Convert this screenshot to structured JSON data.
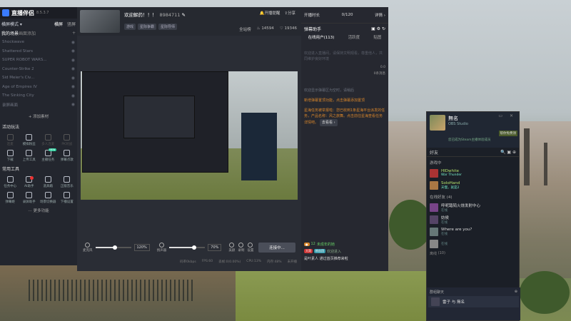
{
  "left_panel": {
    "app_name": "直播伴侣",
    "version": "8.5.3.7",
    "mode": "横屏模式 ▾",
    "mode_options": [
      "横屏",
      "竖屏"
    ],
    "tabs": [
      "我的场景",
      "画面",
      "添加"
    ],
    "scenes": [
      "Shockwave",
      "Shattered Stars",
      "SUPER ROBOT WARS...",
      "Counter-Strike 2",
      "Sid Meier's Civ...",
      "Age of Empires IV",
      "The Sinking City",
      "录屏画面"
    ],
    "add_material": "+ 添加素材",
    "activity_title": "活动玩法",
    "activity_items": [
      {
        "label": "连麦",
        "dim": true
      },
      {
        "label": "模拟粉丝",
        "dim": false
      },
      {
        "label": "多人连麦",
        "dim": true
      },
      {
        "label": "PK对战",
        "dim": true
      },
      {
        "label": "下载",
        "dim": false
      },
      {
        "label": "上传工具",
        "dim": false
      },
      {
        "label": "主播任务",
        "dim": false,
        "new_badge": "NEW"
      },
      {
        "label": "弹幕点歌",
        "dim": false
      }
    ],
    "tools_title": "常用工具",
    "tool_items": [
      {
        "label": "任务中心",
        "dot": false
      },
      {
        "label": "AI助手",
        "dot": true
      },
      {
        "label": "道具箱",
        "dot": false
      },
      {
        "label": "正版音乐",
        "dot": false
      },
      {
        "label": "弹幕姬",
        "dot": false
      },
      {
        "label": "录屏助手",
        "dot": false
      },
      {
        "label": "场景切换器",
        "dot": false
      },
      {
        "label": "下播设置",
        "dot": false
      }
    ],
    "more_func": "更多功能"
  },
  "main": {
    "title": "欢迎解药！！！",
    "room_id": "8984711",
    "tags": [
      "游戏",
      "星际争霸",
      "星际导师"
    ],
    "actions": [
      "开播提醒",
      "分享"
    ],
    "stats": {
      "label": "全站榜",
      "viewers": "14594",
      "likes": "19346"
    },
    "mic_label": "麦克风",
    "mic_percent": "120%",
    "speaker_label": "扬声器",
    "speaker_percent": "70%",
    "tool_icons": [
      "美颜",
      "录制",
      "设置"
    ],
    "connect_label": "连接中...",
    "mic_level": 0.55,
    "speaker_level": 0.7,
    "status": [
      "码率0kbps",
      "FPS:60",
      "丢帧:0(0.00%)",
      "CPU:13%",
      "内存:48%",
      "未开播"
    ]
  },
  "chat": {
    "top_label": "开播时长",
    "top_count": "0/120",
    "top_detail": "详情 ›",
    "title": "弹幕助手",
    "tabs": [
      "在线用户(113)",
      "活跃度",
      "贴图"
    ],
    "msgs": [
      "欢迎进入直播间，请保持文明观看，尊重他人，共同维护良好环境",
      "欢迎显示弹幕区为空时，请稍后",
      "新增弹幕置顶功能，点击弹幕添加置顶"
    ],
    "promo": "星海任务被举报啦：您已收到1条星海平台派发的任务，产品名称：风之旅舞。点击前往星海查看任务详情吧。",
    "go_look": "去看看 ›",
    "side_note": "0条消息",
    "side_val": "0.0",
    "bottom_user": "未成年的她",
    "bottom_tag1": "大哥",
    "bottom_tag2": "粉丝团",
    "bottom_tag3": "12",
    "bottom_enter": "欢迎进入",
    "bottom_join": "是叶素人 通过首页推荐来啦"
  },
  "steam": {
    "name": "無名",
    "status": "OBS Studio",
    "banner": "帮你免费领",
    "notice": "您已成为Steam主播体验成员",
    "friends_label": "好友",
    "ingame_label": "游戏中",
    "ingame": [
      {
        "name": "HIDwhite",
        "game": "War Thunder"
      },
      {
        "name": "SoloHand",
        "game": "天慢，就是2"
      }
    ],
    "online_label": "在线好友",
    "online_count": "4",
    "online": [
      {
        "name": "呼呢踏鸫火烧发射中心",
        "status": "在线"
      },
      {
        "name": "妨侯",
        "status": "在线"
      },
      {
        "name": "Where are you?",
        "status": "在线"
      },
      {
        "name": "",
        "status": "在线"
      }
    ],
    "offline_label": "离线",
    "offline_count": "10",
    "group_chat_label": "群组聊天",
    "group_chat": "雷子 与 無名"
  }
}
